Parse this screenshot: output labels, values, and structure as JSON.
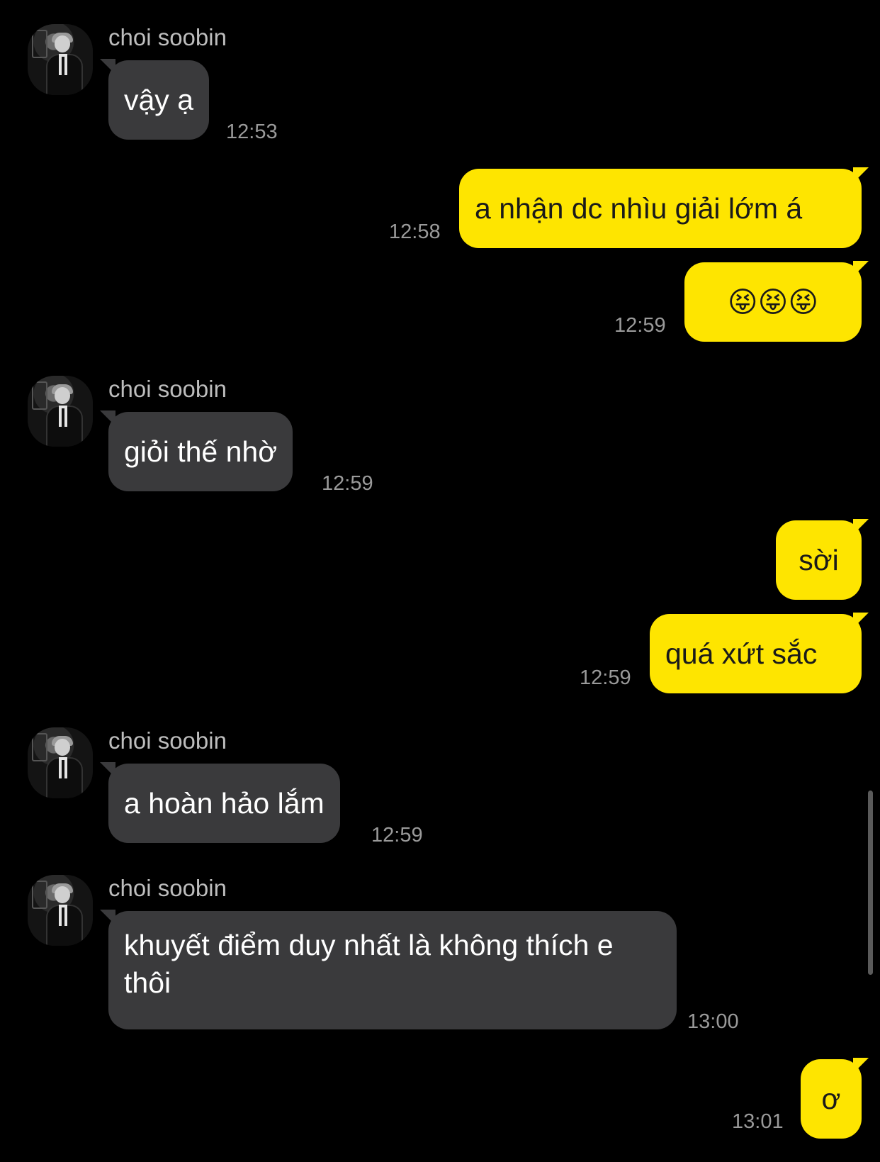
{
  "chat": {
    "sender_name": "choi soobin",
    "messages": [
      {
        "id": 1,
        "direction": "in",
        "text": "vậy ạ",
        "time": "12:53"
      },
      {
        "id": 2,
        "direction": "out",
        "text": "a nhận dc nhìu giải lớm á",
        "time": "12:58"
      },
      {
        "id": 3,
        "direction": "out",
        "text": "😝😝😝",
        "time": "12:59"
      },
      {
        "id": 4,
        "direction": "in",
        "text": "giỏi thế nhờ",
        "time": "12:59"
      },
      {
        "id": 5,
        "direction": "out",
        "text": "sời",
        "time": ""
      },
      {
        "id": 6,
        "direction": "out",
        "text": "quá xứt sắc",
        "time": "12:59"
      },
      {
        "id": 7,
        "direction": "in",
        "text": "a hoàn hảo lắm",
        "time": "12:59"
      },
      {
        "id": 8,
        "direction": "in",
        "text": "khuyết điểm duy nhất là không thích e thôi",
        "time": "13:00"
      },
      {
        "id": 9,
        "direction": "out",
        "text": "ơ",
        "time": "13:01"
      }
    ]
  },
  "colors": {
    "background": "#000000",
    "incoming_bubble": "#3a3a3c",
    "outgoing_bubble": "#fee500",
    "timestamp": "#9a9a9a",
    "sender_name": "#bdbdbd"
  },
  "icons": {
    "avatar": "profile-photo-avatar"
  }
}
